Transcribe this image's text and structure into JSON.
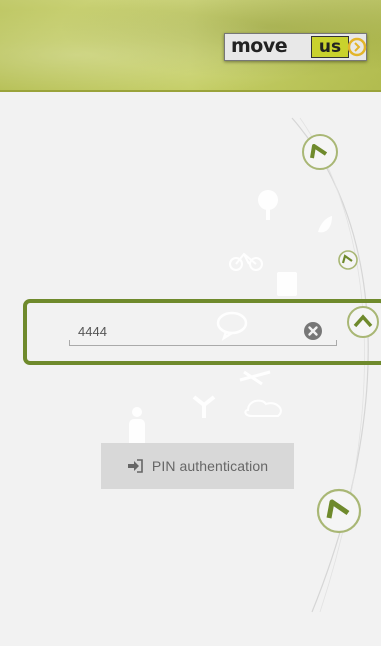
{
  "header": {
    "logo": {
      "word_move": "move",
      "word_us": "us"
    },
    "brand_color": "#c4ce5e"
  },
  "pin_field": {
    "value": "4444",
    "placeholder": "",
    "clear_icon": "clear-circle-icon"
  },
  "auth_button": {
    "label": "PIN authentication",
    "icon": "sign-in-arrow-icon"
  },
  "colors": {
    "accent": "#6f8a2c",
    "background": "#f2f2f2",
    "button_bg": "#d8d8d8"
  }
}
